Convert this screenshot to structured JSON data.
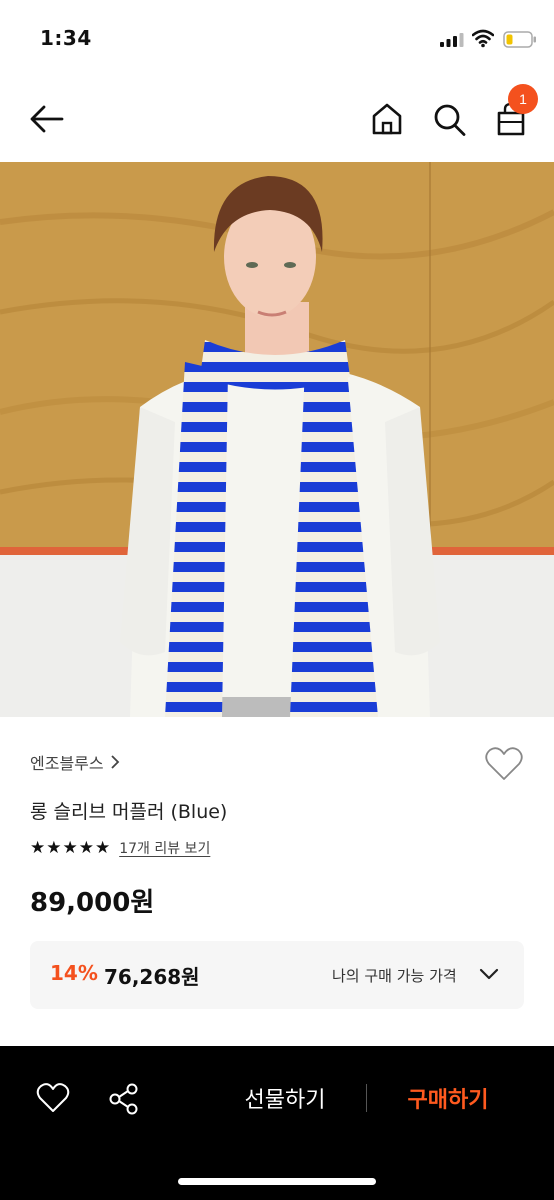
{
  "status_bar": {
    "time": "1:34",
    "icons": [
      "signal-icon",
      "wifi-icon",
      "battery-icon"
    ]
  },
  "nav": {
    "icons": [
      "back-arrow-icon",
      "home-icon",
      "search-icon",
      "shopping-bag-icon"
    ],
    "cart_count": "1",
    "accent_color": "#f4511e"
  },
  "product": {
    "brand": "엔조블루스",
    "name": "롱 슬리브 머플러 (Blue)",
    "rating_stars": 5,
    "stars_text": "★★★★★",
    "review_link": "17개 리뷰 보기",
    "price": "89,000원",
    "discount": {
      "rate": "14%",
      "price": "76,268원",
      "label": "나의 구매 가능 가격"
    }
  },
  "bottom_bar": {
    "icons": [
      "heart-icon",
      "share-icon"
    ],
    "gift_label": "선물하기",
    "buy_label": "구매하기",
    "buy_color": "#ff5a1f"
  }
}
